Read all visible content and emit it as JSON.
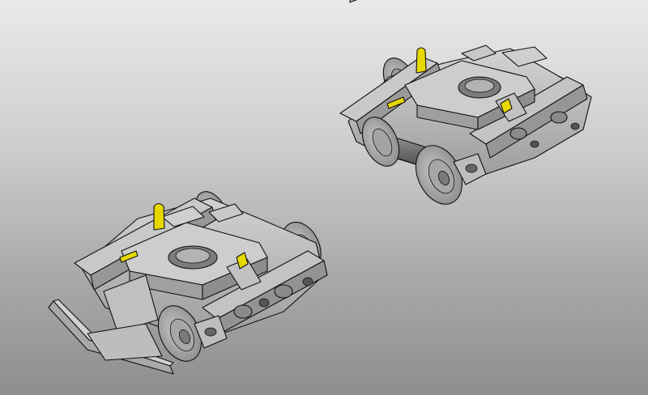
{
  "scene": {
    "background_top": "#e9e9e9",
    "background_bottom": "#8e8e8e",
    "part_fill": "#b8b8b8",
    "part_dark": "#8a8a8a",
    "part_light": "#d6d6d6",
    "axle_fill": "#7d7d7d",
    "accent_yellow": "#e6d800",
    "edge_color": "#111111"
  }
}
